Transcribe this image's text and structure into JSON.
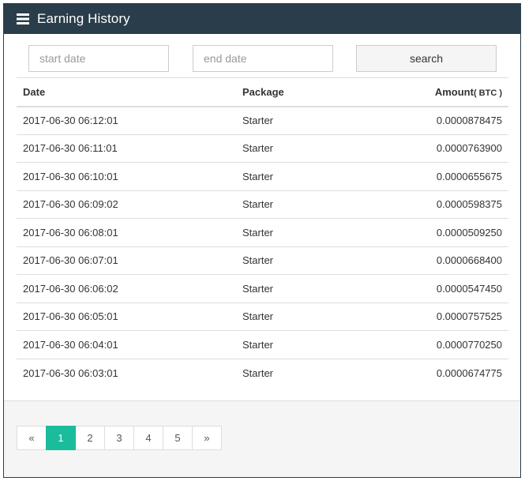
{
  "panel": {
    "title": "Earning History",
    "header_color": "#2a3d4a"
  },
  "filters": {
    "start_placeholder": "start date",
    "end_placeholder": "end date",
    "search_label": "search"
  },
  "table": {
    "headers": {
      "date": "Date",
      "package": "Package",
      "amount": "Amount",
      "amount_unit": "( BTC )"
    },
    "rows": [
      {
        "date": "2017-06-30 06:12:01",
        "package": "Starter",
        "amount": "0.0000878475"
      },
      {
        "date": "2017-06-30 06:11:01",
        "package": "Starter",
        "amount": "0.0000763900"
      },
      {
        "date": "2017-06-30 06:10:01",
        "package": "Starter",
        "amount": "0.0000655675"
      },
      {
        "date": "2017-06-30 06:09:02",
        "package": "Starter",
        "amount": "0.0000598375"
      },
      {
        "date": "2017-06-30 06:08:01",
        "package": "Starter",
        "amount": "0.0000509250"
      },
      {
        "date": "2017-06-30 06:07:01",
        "package": "Starter",
        "amount": "0.0000668400"
      },
      {
        "date": "2017-06-30 06:06:02",
        "package": "Starter",
        "amount": "0.0000547450"
      },
      {
        "date": "2017-06-30 06:05:01",
        "package": "Starter",
        "amount": "0.0000757525"
      },
      {
        "date": "2017-06-30 06:04:01",
        "package": "Starter",
        "amount": "0.0000770250"
      },
      {
        "date": "2017-06-30 06:03:01",
        "package": "Starter",
        "amount": "0.0000674775"
      }
    ]
  },
  "pagination": {
    "prev": "«",
    "next": "»",
    "pages": [
      "1",
      "2",
      "3",
      "4",
      "5"
    ],
    "active": "1",
    "active_color": "#1abc9c"
  }
}
